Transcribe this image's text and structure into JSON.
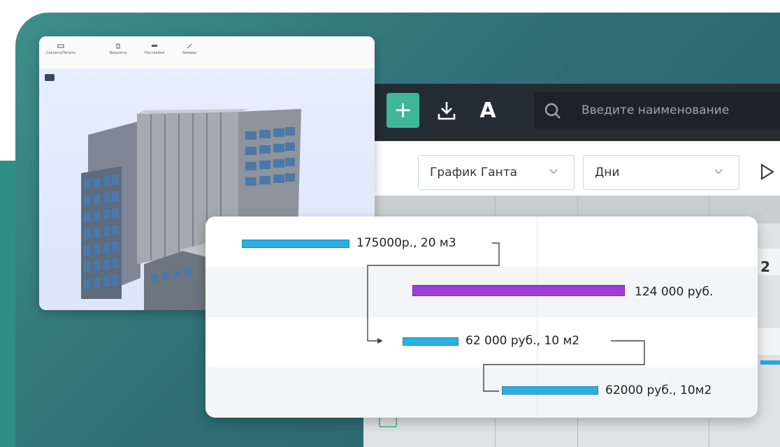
{
  "toolbar": {
    "add_label": "+",
    "font_label": "A",
    "search_placeholder": "Введите наименование"
  },
  "filters": {
    "view_select": "График Ганта",
    "scale_select": "Дни"
  },
  "grid": {
    "side_number": "2"
  },
  "bim_viewer": {
    "toolbar_items": [
      {
        "label": "Скачать/Печать",
        "icon": "printer-icon"
      },
      {
        "label": "Виджеты",
        "icon": "widget-icon"
      },
      {
        "label": "Настройки",
        "icon": "settings-icon"
      },
      {
        "label": "Замеры",
        "icon": "ruler-icon"
      }
    ]
  },
  "gantt": {
    "tasks": [
      {
        "label": "175000р., 20 м3",
        "color": "#2ab0e5"
      },
      {
        "label": "124 000 руб.",
        "color": "#9b3fd8"
      },
      {
        "label": "62 000 руб., 10 м2",
        "color": "#2ab0e5"
      },
      {
        "label": "62000 руб., 10м2",
        "color": "#2ab0e5"
      }
    ]
  },
  "colors": {
    "accent": "#3fb59a",
    "toolbar_bg": "#232c33",
    "card_bg": "#2f6f76"
  }
}
